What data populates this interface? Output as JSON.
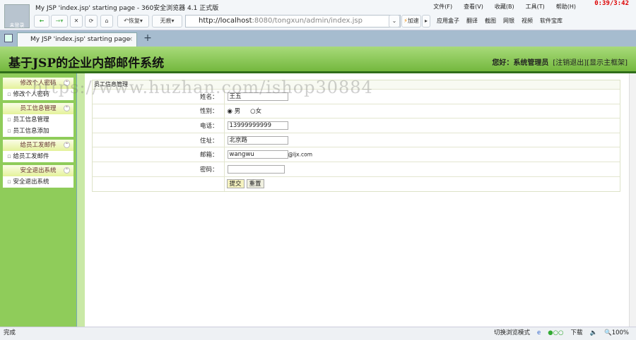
{
  "window": {
    "title": "My JSP 'index.jsp' starting page - 360安全浏览器 4.1 正式版",
    "avatar_label": "未登录",
    "timer": "0:39/3:42",
    "menu": [
      "文件(F)",
      "查看(V)",
      "收藏(B)",
      "工具(T)",
      "帮助(H)"
    ]
  },
  "toolbar": {
    "restore": "恢复",
    "no_ads": "无痕",
    "url_host": "http://localhost",
    "url_rest": ":8080/tongxun/admin/index.jsp",
    "speedup": "加速",
    "tools": [
      "应用盒子",
      "翻译",
      "截图",
      "网银",
      "视频",
      "软件宝库"
    ]
  },
  "tab": {
    "label": "My JSP 'index.jsp' starting page"
  },
  "header": {
    "title": "基于JSP的企业内部邮件系统",
    "greeting": "您好：系统管理员",
    "logout": "[注销退出]",
    "show_frame": "[显示主框架]"
  },
  "sidebar": [
    {
      "title": "修改个人密码",
      "items": [
        "修改个人密码"
      ]
    },
    {
      "title": "员工信息管理",
      "items": [
        "员工信息管理",
        "员工信息添加"
      ]
    },
    {
      "title": "给员工发邮件",
      "items": [
        "给员工发邮件"
      ]
    },
    {
      "title": "安全退出系统",
      "items": [
        "安全退出系统"
      ]
    }
  ],
  "form": {
    "heading": "员工信息管理",
    "name_label": "姓名：",
    "name": "王五",
    "gender_label": "性别：",
    "male": "男",
    "female": "女",
    "phone_label": "电话：",
    "phone": "13999999999",
    "address_label": "住址：",
    "address": "北京路",
    "email_label": "邮箱：",
    "email": "wangwu",
    "email_suffix": "@ljx.com",
    "password_label": "密码：",
    "password": "",
    "submit": "提交",
    "reset": "重置"
  },
  "watermark": "https://www.huzhan.com/ishop30884",
  "status": {
    "left": "完成",
    "mode": "切换浏览模式",
    "download": "下载",
    "zoom": "100%"
  }
}
